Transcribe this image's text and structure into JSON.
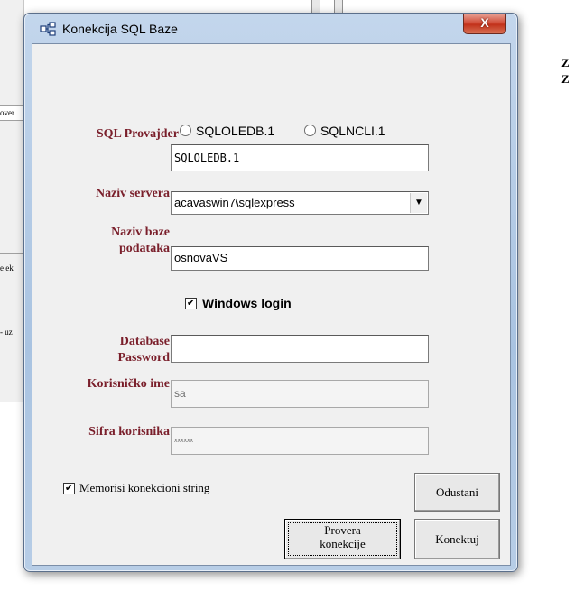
{
  "background": {
    "left_fragments": [
      "over",
      "e ek",
      "- uz"
    ],
    "right_fragments": [
      "Z",
      "Z"
    ]
  },
  "window": {
    "title": "Konekcija SQL Baze",
    "title_icon": "network-icon",
    "close_label": "X"
  },
  "form": {
    "provider": {
      "label": "SQL Provajder",
      "options": [
        "SQLOLEDB.1",
        "SQLNCLI.1"
      ],
      "value": "SQLOLEDB.1"
    },
    "server": {
      "label": "Naziv servera",
      "value": "acavaswin7\\sqlexpress"
    },
    "database": {
      "label_line1": "Naziv baze",
      "label_line2": "podataka",
      "value": "osnovaVS"
    },
    "windows_login": {
      "label": "Windows login",
      "checked": true
    },
    "db_password": {
      "label_line1": "Database",
      "label_line2": "Password",
      "value": ""
    },
    "username": {
      "label": "Korisničko ime",
      "value": "sa"
    },
    "user_password": {
      "label": "Sifra korisnika",
      "value": "xxxxxx"
    },
    "remember": {
      "label": "Memorisi konekcioni string",
      "checked": true
    }
  },
  "buttons": {
    "cancel": "Odustani",
    "test_line1": "Provera",
    "test_line2": "konekcije",
    "connect": "Konektuj"
  },
  "colors": {
    "label": "#7a1f2b",
    "title_glass": "#a9c3e1",
    "close": "#c2321b"
  }
}
